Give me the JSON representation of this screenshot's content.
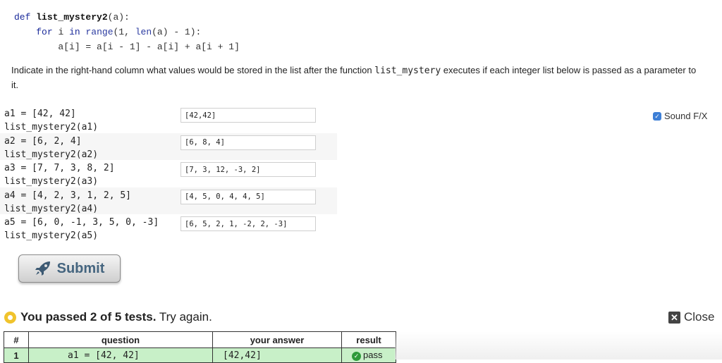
{
  "code": {
    "def_kw": "def",
    "fn_name": "list_mystery2",
    "fn_params": "(a):",
    "for_kw": "for",
    "loop_var": "i",
    "in_kw": "in",
    "range_fn": "range",
    "range_args_a": "(1, ",
    "len_fn": "len",
    "range_args_b": "(a) - 1):",
    "body": "a[i] = a[i - 1] - a[i] + a[i + 1]"
  },
  "instructions": {
    "before": "Indicate in the right-hand column what values would be stored in the list after the function ",
    "func": "list_mystery",
    "after": " executes if each integer list below is passed as a parameter to it."
  },
  "rows": [
    {
      "line1": "a1 = [42, 42]",
      "line2": "list_mystery2(a1)",
      "answer": "[42,42]"
    },
    {
      "line1": "a2 = [6, 2, 4]",
      "line2": "list_mystery2(a2)",
      "answer": "[6, 8, 4]"
    },
    {
      "line1": "a3 = [7, 7, 3, 8, 2]",
      "line2": "list_mystery2(a3)",
      "answer": "[7, 3, 12, -3, 2]"
    },
    {
      "line1": "a4 = [4, 2, 3, 1, 2, 5]",
      "line2": "list_mystery2(a4)",
      "answer": "[4, 5, 0, 4, 4, 5]"
    },
    {
      "line1": "a5 = [6, 0, -1, 3, 5, 0, -3]",
      "line2": "list_mystery2(a5)",
      "answer": "[6, 5, 2, 1, -2, 2, -3]"
    }
  ],
  "sound": {
    "label": "Sound F/X",
    "checked": true
  },
  "submit_label": "Submit",
  "result": {
    "bold": "You passed 2 of 5 tests.",
    "rest": "Try again."
  },
  "close_label": "Close",
  "table": {
    "headers": [
      "#",
      "question",
      "your answer",
      "result"
    ],
    "first_row": {
      "num": "1",
      "question": "a1 = [42, 42]",
      "answer": "[42,42]",
      "result": "pass"
    }
  },
  "colors": {
    "pass_row": "#c8f0c8",
    "result_dot": "#f0c32c",
    "keyword": "#1a2a9a"
  }
}
